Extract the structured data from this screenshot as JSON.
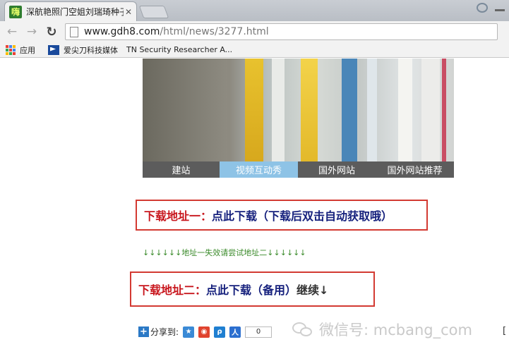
{
  "browser": {
    "tab": {
      "title": "深航艳照门空姐刘瑞琦种子下载",
      "favicon_text": "嗨"
    },
    "url": {
      "host": "www.gdh8.com",
      "path": "/html/news/3277.html"
    },
    "bookmarks": [
      {
        "label": "应用",
        "icon": "apps-grid-icon"
      },
      {
        "label": "爱尖刀科技媒体",
        "icon": "flag-icon"
      },
      {
        "label": "TN  Security Researcher A...",
        "icon": "none"
      }
    ]
  },
  "photo_tabs": [
    {
      "label": "建站",
      "active": false
    },
    {
      "label": "视频互动秀",
      "active": true
    },
    {
      "label": "国外网站",
      "active": false
    },
    {
      "label": "国外网站推荐",
      "active": false
    }
  ],
  "download1": {
    "prefix": "下载地址一：",
    "link": "点此下载（下载后双击自动获取哦）"
  },
  "fallback_note": "↓↓↓↓↓↓地址一失效请尝试地址二↓↓↓↓↓↓",
  "download2": {
    "prefix": "下载地址二：",
    "link": "点此下载（备用）",
    "suffix": "继续↓"
  },
  "share": {
    "label": "分享到:",
    "count": "0"
  },
  "watermark": "微信号: mcbang_com",
  "edge_text": "[",
  "colors": {
    "link_red": "#c8161d",
    "link_navy": "#16217d",
    "box_border": "#d33a32",
    "note_green": "#3a8a2a"
  }
}
